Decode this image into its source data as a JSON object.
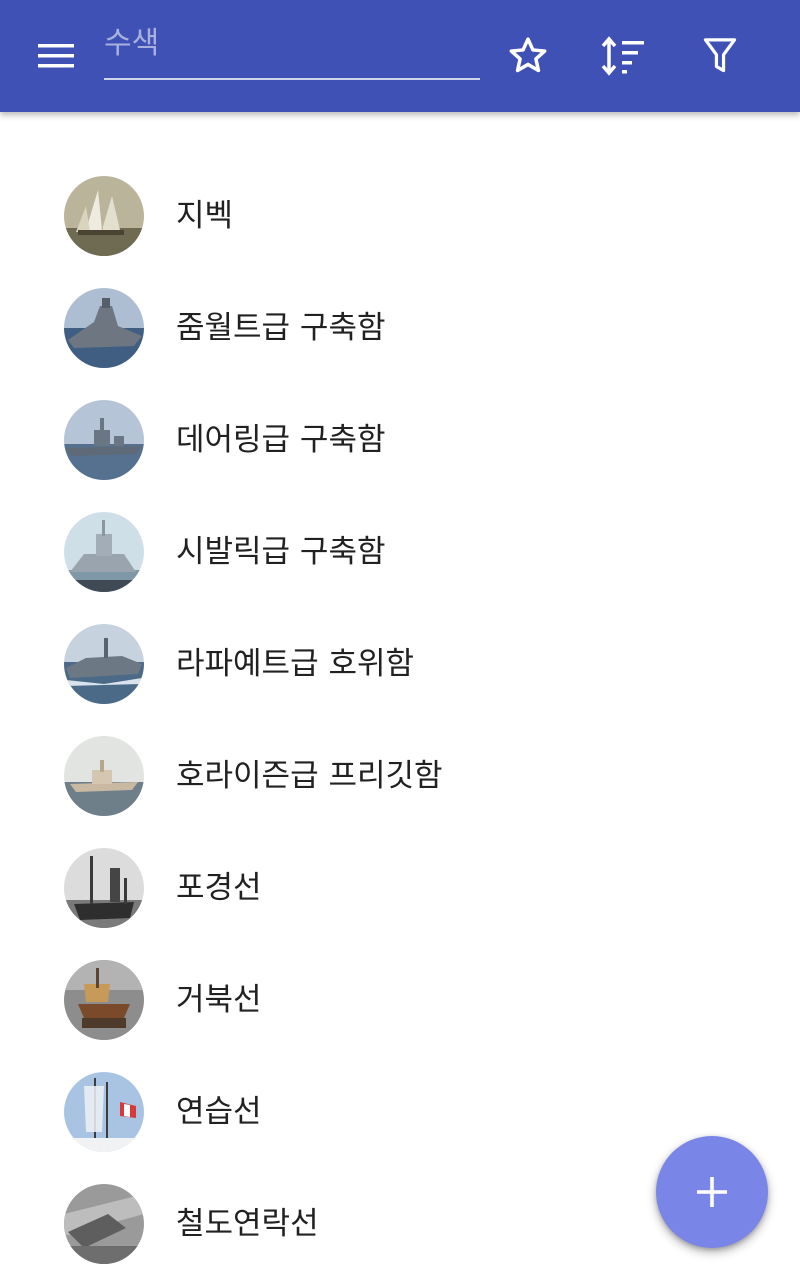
{
  "colors": {
    "appbar": "#3f51b5",
    "fab": "#7986e8",
    "text": "#212121",
    "icon": "#ffffff"
  },
  "toolbar": {
    "menu_icon": "hamburger-menu-icon",
    "search_placeholder": "수색",
    "search_value": "",
    "favorite_icon": "star-outline-icon",
    "sort_icon": "sort-icon",
    "filter_icon": "filter-icon"
  },
  "list": {
    "items": [
      {
        "label": "지벡",
        "thumbnail": "sailing-ship-painting"
      },
      {
        "label": "줌월트급 구축함",
        "thumbnail": "stealth-destroyer-photo"
      },
      {
        "label": "데어링급 구축함",
        "thumbnail": "destroyer-photo"
      },
      {
        "label": "시발릭급 구축함",
        "thumbnail": "destroyer-photo"
      },
      {
        "label": "라파예트급 호위함",
        "thumbnail": "frigate-photo"
      },
      {
        "label": "호라이즌급 프리깃함",
        "thumbnail": "frigate-photo"
      },
      {
        "label": "포경선",
        "thumbnail": "whaling-ship-bw-photo"
      },
      {
        "label": "거북선",
        "thumbnail": "turtle-ship-model-photo"
      },
      {
        "label": "연습선",
        "thumbnail": "tall-ship-photo"
      },
      {
        "label": "철도연락선",
        "thumbnail": "ferry-bw-photo"
      }
    ]
  },
  "fab": {
    "icon": "plus-icon"
  }
}
